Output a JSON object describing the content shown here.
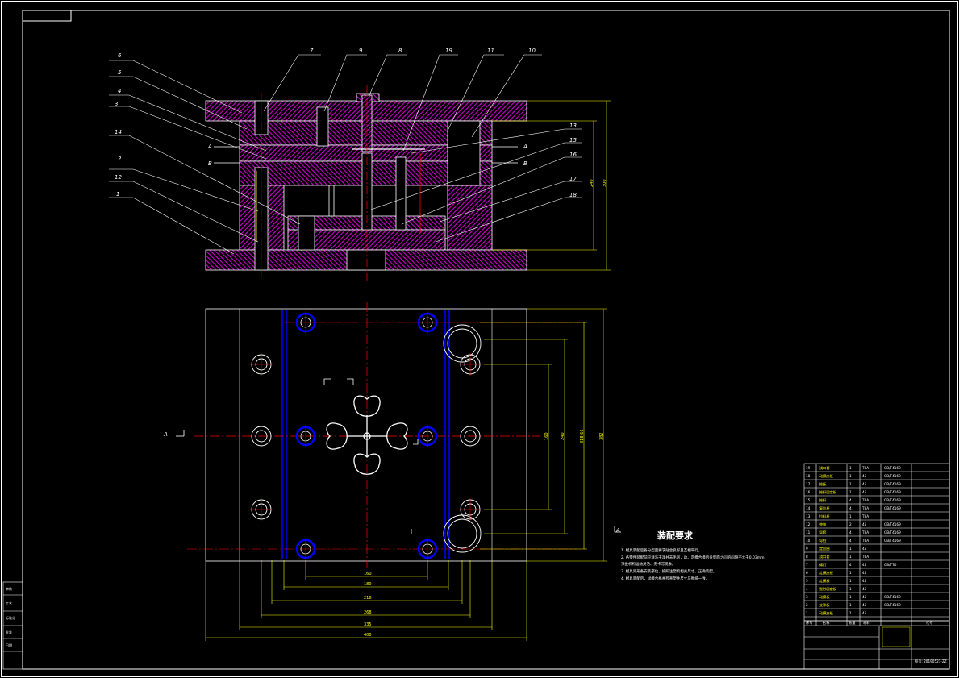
{
  "part_labels": [
    "6",
    "5",
    "4",
    "3",
    "14",
    "2",
    "12",
    "1",
    "7",
    "9",
    "8",
    "19",
    "11",
    "10",
    "13",
    "15",
    "16",
    "17",
    "18"
  ],
  "section_marks": {
    "a": "A",
    "b": "B"
  },
  "view_marks": {
    "left": "A",
    "right": "A"
  },
  "dims": {
    "vertical": [
      "160",
      "240",
      "300",
      "318.66",
      "382"
    ],
    "horizontal": [
      "160",
      "180",
      "216",
      "268",
      "335",
      "400"
    ]
  },
  "notes": {
    "title": "装配要求",
    "lines": [
      "1. 模具装配后各分型面要求贴合良好且互相平行。",
      "2. 各零件装配前应清洗干净并去毛刺，动、定模合模后分型面之间的间隙不大于0.03mm，",
      "   顶出机构运动灵活、无卡滞现象。",
      "3. 模具外形各安装部位，按照注塑机相关尺寸，正确装配。",
      "4. 模具装配后，试模合格并检查塑件尺寸与图纸一致。"
    ]
  },
  "bom": {
    "rows": [
      {
        "no": "19",
        "name": "浇口套",
        "qty": "1",
        "mat": "T8A",
        "std": "GB/T4169"
      },
      {
        "no": "18",
        "name": "动模座板",
        "qty": "1",
        "mat": "45",
        "std": "GB/T4169"
      },
      {
        "no": "17",
        "name": "推板",
        "qty": "1",
        "mat": "45",
        "std": "GB/T4169"
      },
      {
        "no": "16",
        "name": "推杆固定板",
        "qty": "1",
        "mat": "45",
        "std": "GB/T4169"
      },
      {
        "no": "15",
        "name": "推杆",
        "qty": "4",
        "mat": "T8A",
        "std": "GB/T4169"
      },
      {
        "no": "14",
        "name": "复位杆",
        "qty": "4",
        "mat": "T8A",
        "std": "GB/T4169"
      },
      {
        "no": "13",
        "name": "拉料杆",
        "qty": "1",
        "mat": "T8A",
        "std": ""
      },
      {
        "no": "12",
        "name": "垫块",
        "qty": "2",
        "mat": "45",
        "std": "GB/T4169"
      },
      {
        "no": "11",
        "name": "导套",
        "qty": "4",
        "mat": "T8A",
        "std": "GB/T4169"
      },
      {
        "no": "10",
        "name": "导柱",
        "qty": "4",
        "mat": "T8A",
        "std": "GB/T4169"
      },
      {
        "no": "9",
        "name": "定位圈",
        "qty": "1",
        "mat": "45",
        "std": ""
      },
      {
        "no": "8",
        "name": "浇口套",
        "qty": "1",
        "mat": "T8A",
        "std": ""
      },
      {
        "no": "7",
        "name": "螺钉",
        "qty": "4",
        "mat": "45",
        "std": "GB/T70"
      },
      {
        "no": "6",
        "name": "定模座板",
        "qty": "1",
        "mat": "45",
        "std": ""
      },
      {
        "no": "5",
        "name": "定模板",
        "qty": "1",
        "mat": "45",
        "std": ""
      },
      {
        "no": "4",
        "name": "型芯固定板",
        "qty": "1",
        "mat": "45",
        "std": ""
      },
      {
        "no": "3",
        "name": "动模板",
        "qty": "1",
        "mat": "45",
        "std": "GB/T4169"
      },
      {
        "no": "2",
        "name": "支承板",
        "qty": "1",
        "mat": "45",
        "std": "GB/T4169"
      },
      {
        "no": "1",
        "name": "动模座板",
        "qty": "1",
        "mat": "45",
        "std": ""
      }
    ],
    "header": {
      "no": "序号",
      "name": "名称",
      "qty": "数量",
      "mat": "材料",
      "std": "代号"
    },
    "drawing_no": "图号: 20190521-ZZ"
  },
  "side_table": [
    "审核",
    "工艺",
    "标准化",
    "批准",
    "日期"
  ],
  "colors": {
    "background": "#000000",
    "hatch": "#cc00cc",
    "outline": "#ffffff",
    "dimension": "#ffff00",
    "centerline": "#ff0000",
    "blue": "#0000ff"
  }
}
